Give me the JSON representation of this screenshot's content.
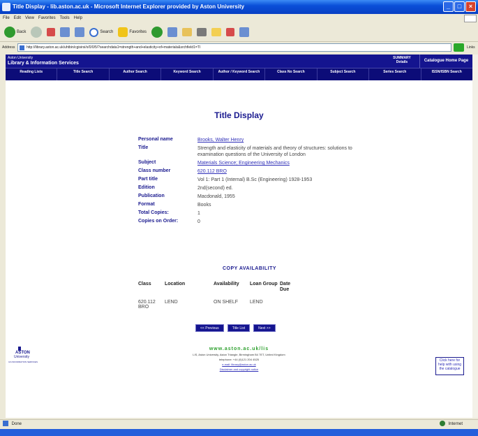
{
  "window": {
    "title": "Title Display - lib.aston.ac.uk - Microsoft Internet Explorer provided by Aston University"
  },
  "menu": [
    "File",
    "Edit",
    "View",
    "Favorites",
    "Tools",
    "Help"
  ],
  "toolbar": {
    "back_label": "Back",
    "search_label": "Search",
    "favorites_label": "Favorites"
  },
  "address": {
    "label": "Address",
    "value": "http://library.aston.ac.uk/uhtbin/cgisirsi/x/0/0/5/?searchdata1=strength+and+elasticity+of+materials&srchfield1=TI",
    "links_label": "Links"
  },
  "library": {
    "university": "Aston University",
    "service": "Library & Information Services",
    "summary_label": "SUMMARY Details",
    "catalogue_home": "Catalogue Home Page",
    "nav": [
      "Reading Lists",
      "Title Search",
      "Author Search",
      "Keyword Search",
      "Author / Keyword Search",
      "Class No Search",
      "Subject Search",
      "Series Search",
      "ISSN/ISBN Search"
    ]
  },
  "page": {
    "title": "Title Display"
  },
  "record": [
    {
      "label": "Personal name",
      "value": "Brooks, Walter Henry",
      "link": true
    },
    {
      "label": "Title",
      "value": "Strength and elasticity of materials and theory of structures: solutions to examination questions of the University of London",
      "link": false
    },
    {
      "label": "Subject",
      "value": "Materials Science; Engineering Mechanics",
      "link": true
    },
    {
      "label": "Class number",
      "value": "620.112 BRO",
      "link": true
    },
    {
      "label": "Part title",
      "value": "Vol 1: Part 1 (Internal) B.Sc (Engineering) 1928-1953",
      "link": false
    },
    {
      "label": "Edition",
      "value": "2nd(second) ed.",
      "link": false
    },
    {
      "label": "Publication",
      "value": "Macdonald, 1955",
      "link": false
    },
    {
      "label": "Format",
      "value": "Books",
      "link": false
    },
    {
      "label": "Total Copies:",
      "value": "1",
      "link": false
    },
    {
      "label": "Copies on Order:",
      "value": "0",
      "link": false
    }
  ],
  "availability": {
    "title": "COPY AVAILABILITY",
    "headers": [
      "Class",
      "Location",
      "Availability",
      "Loan Group",
      "Date Due"
    ],
    "rows": [
      [
        "620.112 BRO",
        "LEND",
        "ON SHELF",
        "LEND",
        ""
      ]
    ]
  },
  "buttons": {
    "previous": "<< Previous",
    "new_list": "Title List",
    "next": "Next >>"
  },
  "footer": {
    "url": "www.aston.ac.uk/lis",
    "address": "LIS, Aston University, Aston Triangle, Birmingham B4 7ET, United Kingdom",
    "telephone": "telephone: +44 (0)121 204 4525",
    "email": "e-mail: library@aston.ac.uk",
    "disclaimer": "Disclaimer and copyright notice"
  },
  "aston_logo": {
    "name": "ASTON",
    "sub": "University",
    "tag": "ILS INFORMATION SERVICES"
  },
  "help": {
    "text": "Click here for help with using the catalogue"
  },
  "status": {
    "left": "Done",
    "zone": "Internet"
  }
}
